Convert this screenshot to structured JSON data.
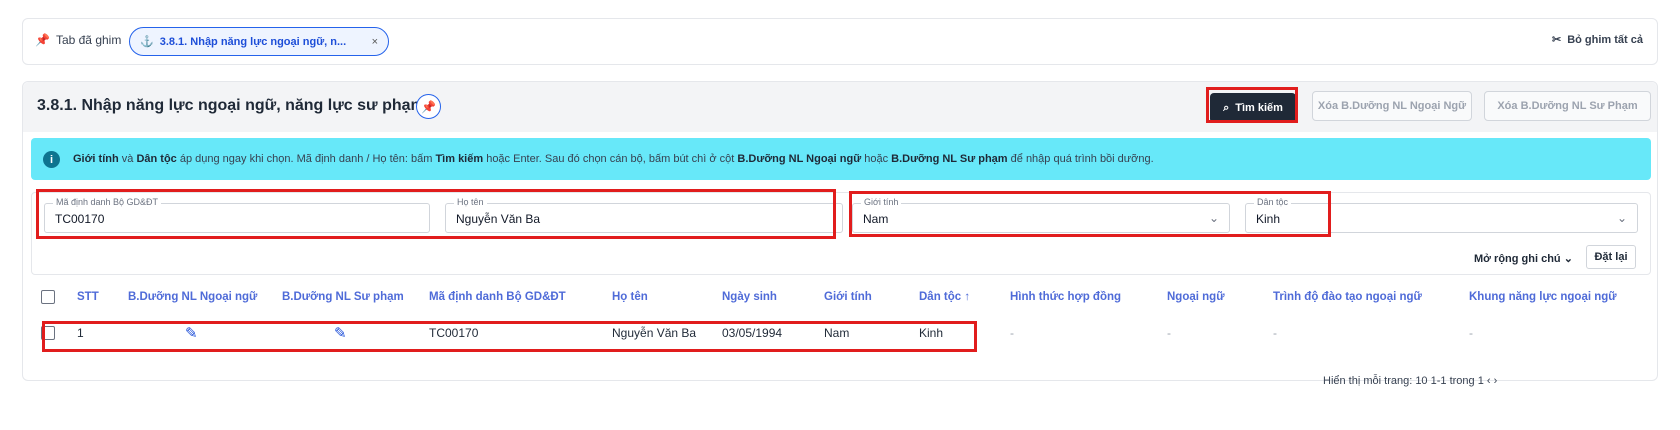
{
  "pinbar": {
    "label": "Tab đã ghim",
    "chip": "3.8.1. Nhập năng lực ngoại ngữ, n...",
    "chip_close": "×",
    "unpin_all": "Bỏ ghim tất cả"
  },
  "header": {
    "title": "3.8.1. Nhập năng lực ngoại ngữ, năng lực sư phạm",
    "search": "Tìm kiếm",
    "btn_clear_nn": "Xóa B.Dưỡng NL Ngoại Ngữ",
    "btn_clear_sp": "Xóa B.Dưỡng NL Sư Phạm"
  },
  "info": {
    "p1": "Giới tính",
    "p2": " và ",
    "p3": "Dân tộc",
    "p4": " áp dụng ngay khi chọn. Mã định danh / Họ tên: bấm ",
    "p5": "Tìm kiếm",
    "p6": " hoặc Enter. Sau đó chọn cán bộ, bấm bút chì ở cột ",
    "p7": "B.Dưỡng NL Ngoại ngữ",
    "p8": " hoặc ",
    "p9": "B.Dưỡng NL Sư phạm",
    "p10": " để nhập quá trình bồi dưỡng."
  },
  "filters": {
    "id_label": "Mã định danh Bộ GD&ĐT",
    "id_value": "TC00170",
    "name_label": "Họ tên",
    "name_value": "Nguyễn Văn Ba",
    "gender_label": "Giới tính",
    "gender_value": "Nam",
    "ethnic_label": "Dân tộc",
    "ethnic_value": "Kinh",
    "expand": "Mở rộng ghi chú",
    "reset": "Đặt lại"
  },
  "table": {
    "headers": [
      "STT",
      "B.Dưỡng NL Ngoại ngữ",
      "B.Dưỡng NL Sư phạm",
      "Mã định danh Bộ GD&ĐT",
      "Họ tên",
      "Ngày sinh",
      "Giới tính",
      "Dân tộc ↑",
      "Hình thức hợp đồng",
      "Ngoại ngữ",
      "Trình độ đào tạo ngoại ngữ",
      "Khung năng lực ngoại ngữ"
    ],
    "row": {
      "stt": "1",
      "id": "TC00170",
      "name": "Nguyễn Văn Ba",
      "dob": "03/05/1994",
      "gender": "Nam",
      "ethnic": "Kinh",
      "dash": "-"
    }
  },
  "pager": {
    "text": "Hiển thị mỗi trang:   10      1-1 trong 1    ‹   ›"
  },
  "colors": {
    "accent": "#2563eb",
    "info_bg": "#67e8f9",
    "highlight": "#e11d1d",
    "header_text": "#4f6bd8"
  }
}
